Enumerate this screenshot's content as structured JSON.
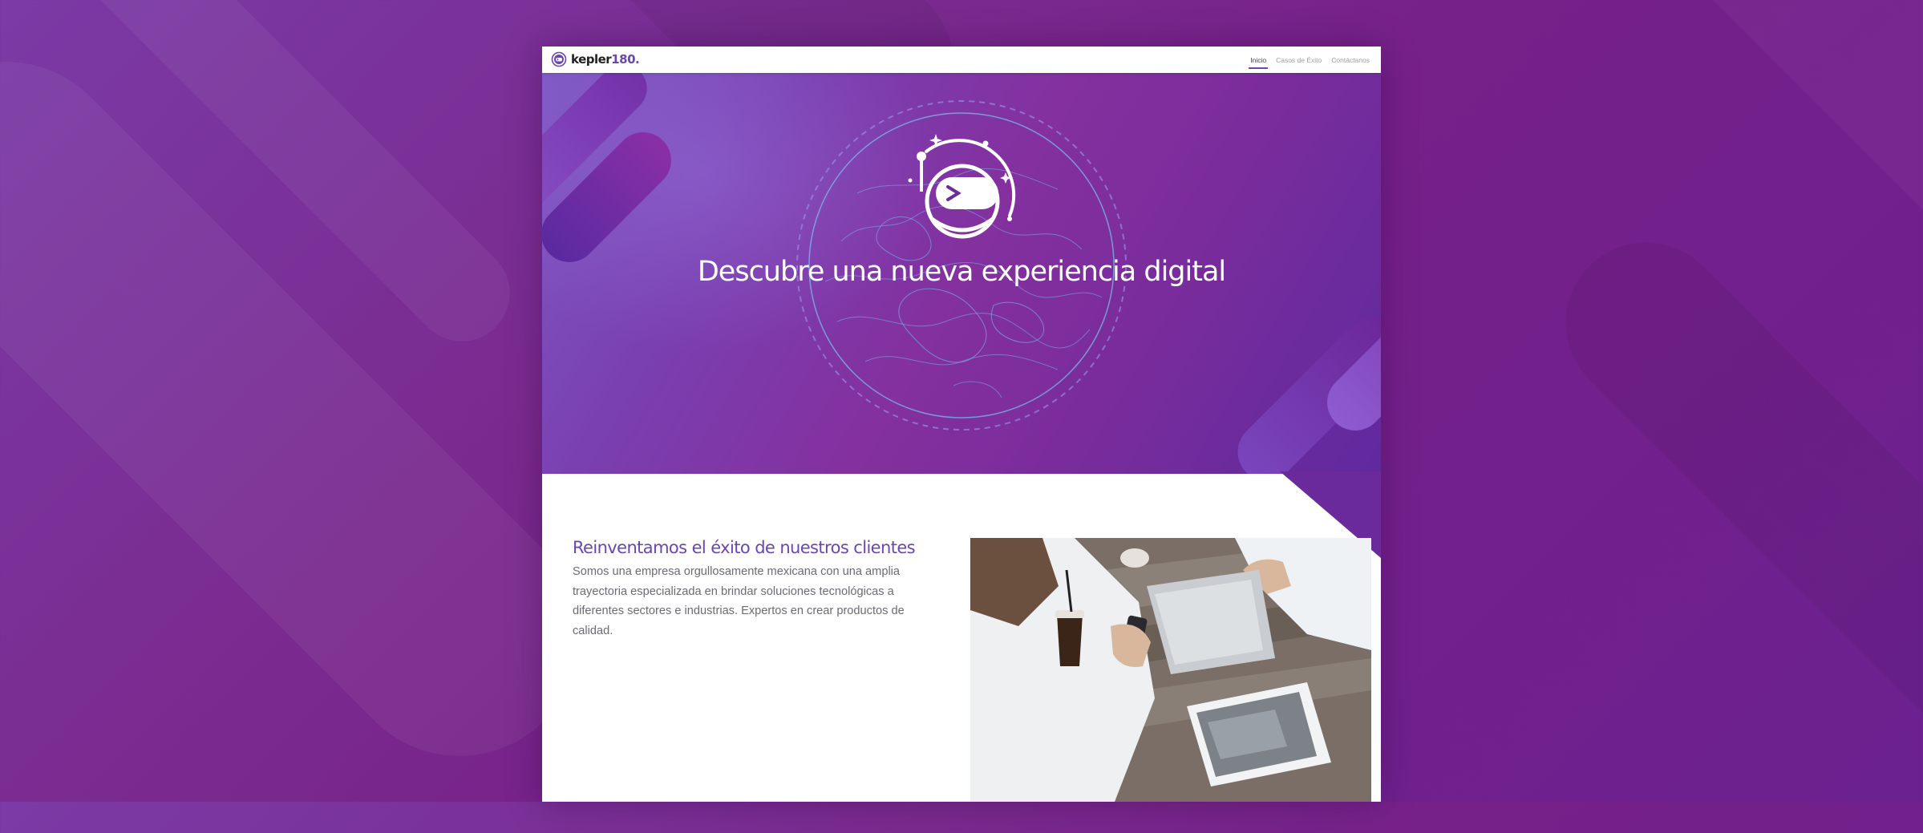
{
  "brand": {
    "name": "kepler",
    "number": "180",
    "dot": "."
  },
  "nav": {
    "items": [
      {
        "label": "Inicio",
        "active": true
      },
      {
        "label": "Casos de Éxito",
        "active": false
      },
      {
        "label": "Contáctanos",
        "active": false
      }
    ]
  },
  "hero": {
    "title": "Descubre una nueva experiencia digital"
  },
  "about": {
    "heading": "Reinventamos el éxito de nuestros clientes",
    "body": "Somos una empresa orgullosamente mexicana con una amplia trayectoria especializada en brindar soluciones tecnológicas a diferentes sectores e industrias. Expertos en crear productos de calidad."
  },
  "colors": {
    "accent": "#6a45b5",
    "background": "#7a2a8e",
    "hero": "#7e3fb0"
  },
  "icons": [
    "astronaut-helmet-icon",
    "globe-map-icon",
    "logo-icon"
  ]
}
